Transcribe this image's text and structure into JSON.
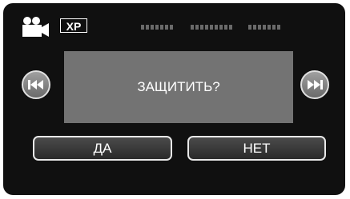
{
  "status": {
    "mode_icon": "video-camera-icon",
    "quality_label": "XP"
  },
  "dialog": {
    "prompt": "ЗАЩИТИТЬ?",
    "prev_icon": "skip-previous-icon",
    "next_icon": "skip-next-icon"
  },
  "buttons": {
    "yes_label": "ДА",
    "no_label": "НЕТ"
  },
  "colors": {
    "screen_bg": "#101010",
    "prompt_bg": "#737373",
    "button_border": "#e8e8e8"
  }
}
